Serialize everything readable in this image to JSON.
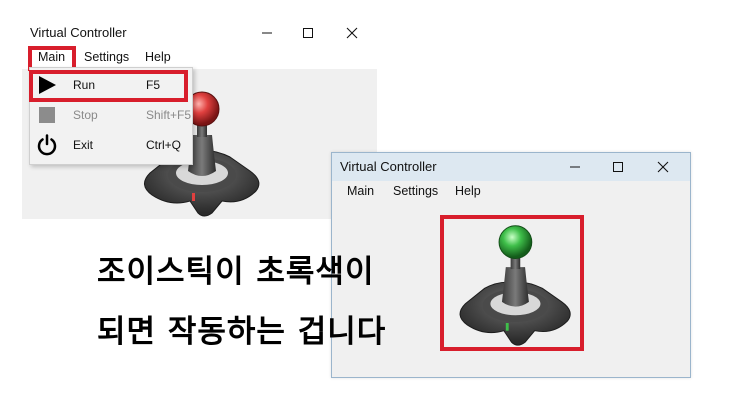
{
  "window1": {
    "title": "Virtual Controller",
    "menu": {
      "main": "Main",
      "settings": "Settings",
      "help": "Help"
    },
    "dropdown": [
      {
        "label": "Run",
        "shortcut": "F5",
        "icon": "play-icon",
        "enabled": true
      },
      {
        "label": "Stop",
        "shortcut": "Shift+F5",
        "icon": "stop-icon",
        "enabled": false
      },
      {
        "label": "Exit",
        "shortcut": "Ctrl+Q",
        "icon": "power-icon",
        "enabled": true
      }
    ],
    "joystick_state": "red"
  },
  "window2": {
    "title": "Virtual Controller",
    "menu": {
      "main": "Main",
      "settings": "Settings",
      "help": "Help"
    },
    "joystick_state": "green"
  },
  "caption": {
    "line1": "조이스틱이 초록색이",
    "line2": "되면 작동하는 겁니다"
  },
  "colors": {
    "highlight": "#d81e2c",
    "joystick_red": "#e0403f",
    "joystick_green": "#3fbf4a"
  }
}
